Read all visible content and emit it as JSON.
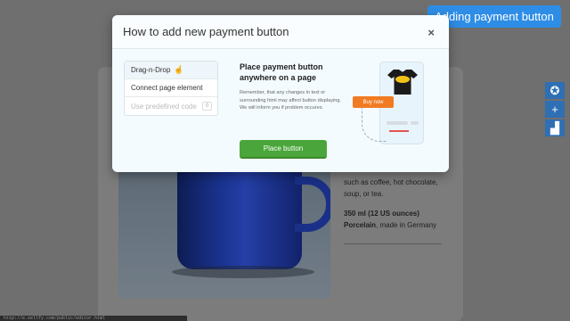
{
  "badge": {
    "label": "Adding payment button"
  },
  "modal": {
    "title": "How to add new payment button",
    "close_icon": "×",
    "tabs": [
      {
        "label": "Drag-n-Drop",
        "active": true
      },
      {
        "label": "Connect page element",
        "active": false
      },
      {
        "label": "Use predefined code",
        "count": "0",
        "disabled": true
      }
    ],
    "headline": "Place payment button anywhere on a page",
    "note": "Remember, that any changes in text or surrounding html may affect button displaying. We will inform you if problem occures.",
    "place_button": "Place button",
    "buy_now": "Buy now"
  },
  "background": {
    "line1": "such as coffee, hot chocolate,",
    "line2": "soup, or tea.",
    "volume": "350 ml (12 US ounces)",
    "material_bold": "Porcelain",
    "material_rest": ", made in Germany"
  },
  "side_tools": [
    {
      "icon": "star-badge-icon",
      "glyph": "✪"
    },
    {
      "icon": "plus-icon",
      "glyph": "+"
    },
    {
      "icon": "chart-icon",
      "glyph": "▟"
    }
  ],
  "status_bar": {
    "text": "http://e.sellfy.com/public/editor.html"
  },
  "colors": {
    "accent": "#2e8de6",
    "primary_button": "#4aa63a",
    "buy_now": "#f17b22"
  }
}
